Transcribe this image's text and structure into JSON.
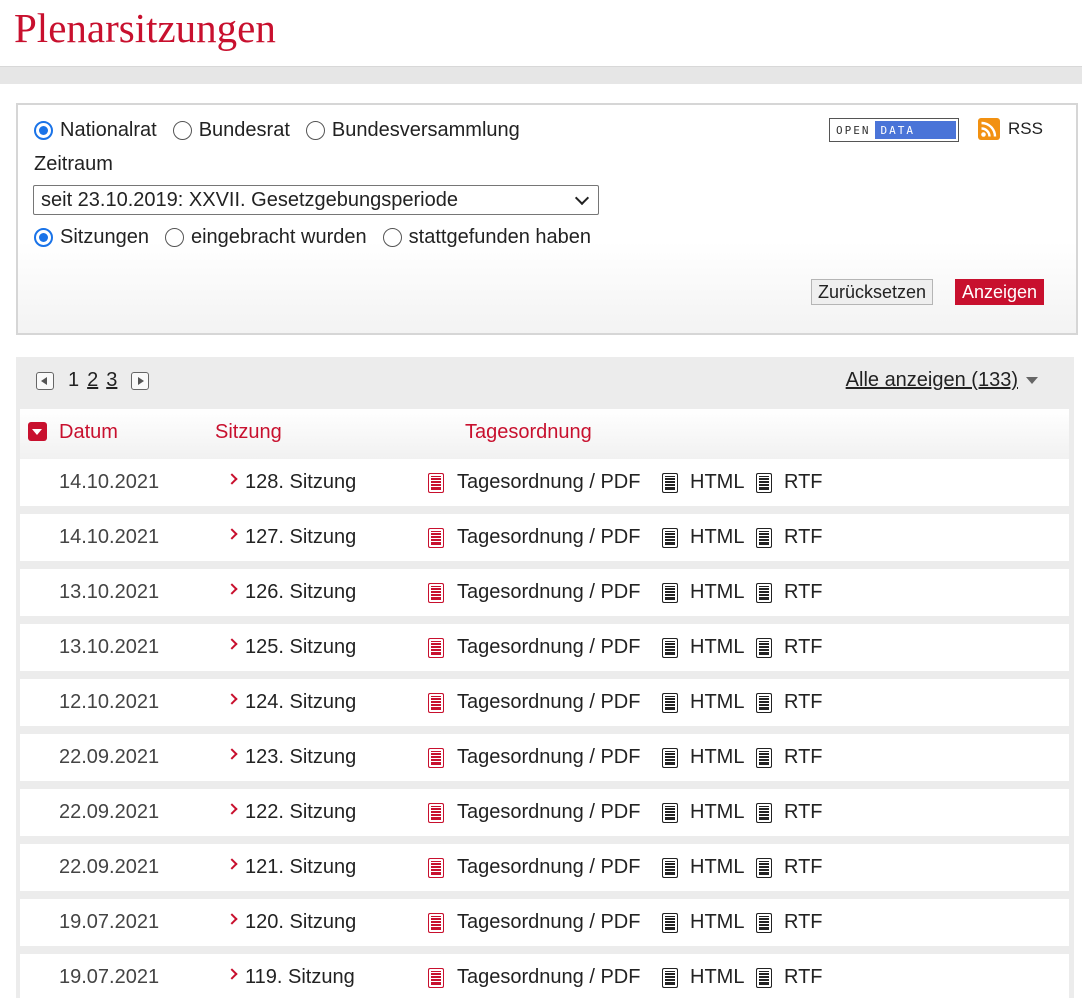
{
  "page": {
    "title": "Plenarsitzungen"
  },
  "filter": {
    "chambers": [
      {
        "label": "Nationalrat",
        "checked": true
      },
      {
        "label": "Bundesrat",
        "checked": false
      },
      {
        "label": "Bundesversammlung",
        "checked": false
      }
    ],
    "zeitraum_label": "Zeitraum",
    "period_selected": "seit 23.10.2019: XXVII. Gesetzgebungsperiode",
    "mode": [
      {
        "label": "Sitzungen",
        "checked": true
      },
      {
        "label": "eingebracht wurden",
        "checked": false
      },
      {
        "label": "stattgefunden haben",
        "checked": false
      }
    ],
    "opendata": {
      "left": "OPEN",
      "right": "DATA"
    },
    "rss_label": "RSS",
    "reset_label": "Zurücksetzen",
    "show_label": "Anzeigen"
  },
  "pagination": {
    "pages": [
      "1",
      "2",
      "3"
    ],
    "current": "1",
    "show_all": "Alle anzeigen (133)"
  },
  "table": {
    "headers": {
      "date": "Datum",
      "session": "Sitzung",
      "agenda": "Tagesordnung"
    },
    "link_labels": {
      "pdf": "Tagesordnung / PDF",
      "html": "HTML",
      "rtf": "RTF"
    },
    "rows": [
      {
        "date": "14.10.2021",
        "session": "128. Sitzung"
      },
      {
        "date": "14.10.2021",
        "session": "127. Sitzung"
      },
      {
        "date": "13.10.2021",
        "session": "126. Sitzung"
      },
      {
        "date": "13.10.2021",
        "session": "125. Sitzung"
      },
      {
        "date": "12.10.2021",
        "session": "124. Sitzung"
      },
      {
        "date": "22.09.2021",
        "session": "123. Sitzung"
      },
      {
        "date": "22.09.2021",
        "session": "122. Sitzung"
      },
      {
        "date": "22.09.2021",
        "session": "121. Sitzung"
      },
      {
        "date": "19.07.2021",
        "session": "120. Sitzung"
      },
      {
        "date": "19.07.2021",
        "session": "119. Sitzung"
      }
    ]
  },
  "colors": {
    "accent": "#c8102e",
    "radio": "#1a73e8",
    "opendata_blue": "#4a74d8",
    "rss": "#f29111"
  }
}
